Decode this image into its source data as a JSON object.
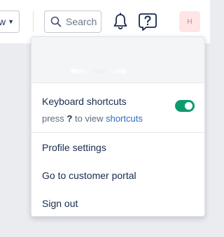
{
  "topbar": {
    "view_label": "w",
    "search_placeholder": "Search",
    "avatar_initial": "H"
  },
  "menu": {
    "shortcuts_title": "Keyboard shortcuts",
    "shortcuts_hint_prefix": "press",
    "shortcuts_key": "?",
    "shortcuts_hint_middle": "to view",
    "shortcuts_link": "shortcuts",
    "shortcuts_enabled": true,
    "items": [
      {
        "label": "Profile settings"
      },
      {
        "label": "Go to customer portal"
      },
      {
        "label": "Sign out"
      }
    ]
  },
  "colors": {
    "toggle_on": "#0f9a6e",
    "link": "#2b6cc4",
    "avatar_bg": "#ffe5e6"
  }
}
